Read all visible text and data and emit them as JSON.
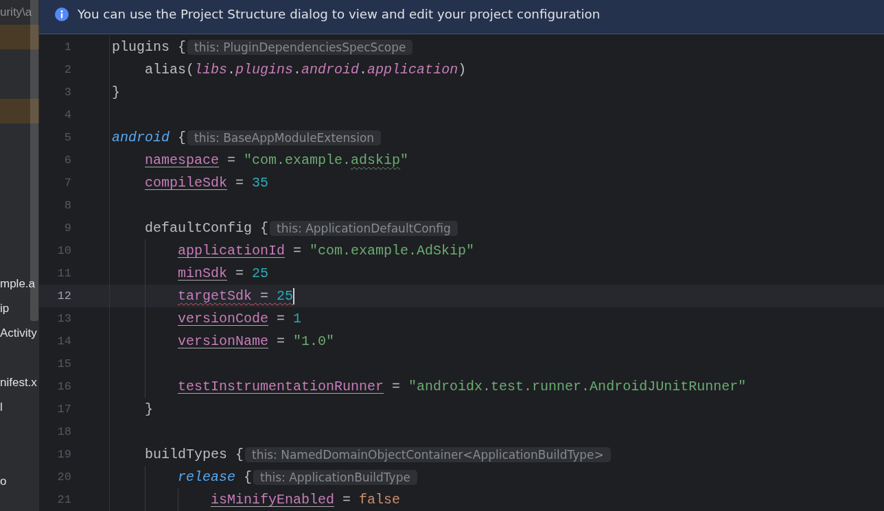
{
  "project_panel": {
    "rows": [
      {
        "label": "urity\\a",
        "kind": "path",
        "highlighted": false
      },
      {
        "highlighted": true
      },
      {
        "highlighted": false
      },
      {
        "highlighted": false
      },
      {
        "highlighted": true
      },
      {
        "highlighted": false
      },
      {
        "highlighted": false
      },
      {
        "highlighted": false
      },
      {
        "highlighted": false
      },
      {
        "highlighted": false
      },
      {
        "highlighted": false
      },
      {
        "label": "mple.a",
        "kind": "file",
        "highlighted": false
      },
      {
        "label": "ip",
        "kind": "file",
        "highlighted": false
      },
      {
        "label": "Activity",
        "kind": "file",
        "highlighted": false
      },
      {
        "highlighted": false
      },
      {
        "label": "nifest.x",
        "kind": "file",
        "highlighted": false
      },
      {
        "label": "l",
        "kind": "file",
        "highlighted": false
      },
      {
        "highlighted": false
      },
      {
        "highlighted": false
      },
      {
        "label": "o",
        "kind": "file",
        "highlighted": false
      }
    ]
  },
  "banner": {
    "message": "You can use the Project Structure dialog to view and edit your project configuration"
  },
  "editor": {
    "lines": [
      {
        "number": "1",
        "current": false,
        "warning": false,
        "tokens": [
          {
            "text": "plugins {",
            "kind": "plain"
          },
          {
            "text": "this: PluginDependenciesSpecScope",
            "kind": "hint"
          }
        ],
        "children": [
          {
            "number": "2",
            "current": false,
            "warning": false,
            "tokens": [
              {
                "text": "alias(",
                "kind": "plain"
              },
              {
                "text": "libs",
                "kind": "member"
              },
              {
                "text": ".",
                "kind": "plain"
              },
              {
                "text": "plugins",
                "kind": "member"
              },
              {
                "text": ".",
                "kind": "plain"
              },
              {
                "text": "android",
                "kind": "member"
              },
              {
                "text": ".",
                "kind": "plain"
              },
              {
                "text": "application",
                "kind": "member"
              },
              {
                "text": ")",
                "kind": "plain"
              }
            ]
          }
        ]
      },
      {
        "number": "3",
        "current": false,
        "warning": false,
        "tokens": [
          {
            "text": "}",
            "kind": "plain"
          }
        ]
      },
      {
        "number": "4",
        "current": false
      },
      {
        "number": "5",
        "current": false,
        "warning": false,
        "tokens": [
          {
            "text": "android",
            "kind": "receiver"
          },
          {
            "text": " {",
            "kind": "plain"
          },
          {
            "text": "this: BaseAppModuleExtension",
            "kind": "hint"
          }
        ],
        "children": [
          {
            "number": "6",
            "current": false,
            "warning": false,
            "tokens": [
              {
                "text": "namespace",
                "kind": "property"
              },
              {
                "text": " = ",
                "kind": "plain"
              },
              {
                "text": "\"com.example.",
                "kind": "string"
              },
              {
                "text": "adskip",
                "kind": "misspelling"
              },
              {
                "text": "\"",
                "kind": "string"
              }
            ]
          },
          {
            "number": "7",
            "current": false,
            "warning": false,
            "tokens": [
              {
                "text": "compileSdk",
                "kind": "property"
              },
              {
                "text": " = ",
                "kind": "plain"
              },
              {
                "text": "35",
                "kind": "number"
              }
            ]
          },
          {
            "number": "8",
            "current": false
          },
          {
            "number": "9",
            "current": false,
            "warning": false,
            "tokens": [
              {
                "text": "defaultConfig {",
                "kind": "plain"
              },
              {
                "text": "this: ApplicationDefaultConfig",
                "kind": "hint"
              }
            ],
            "children": [
              {
                "number": "10",
                "current": false,
                "warning": false,
                "tokens": [
                  {
                    "text": "applicationId",
                    "kind": "property"
                  },
                  {
                    "text": " = ",
                    "kind": "plain"
                  },
                  {
                    "text": "\"com.example.AdSkip\"",
                    "kind": "string"
                  }
                ]
              },
              {
                "number": "11",
                "current": false,
                "warning": false,
                "tokens": [
                  {
                    "text": "minSdk",
                    "kind": "property"
                  },
                  {
                    "text": " = ",
                    "kind": "plain"
                  },
                  {
                    "text": "25",
                    "kind": "number"
                  }
                ]
              },
              {
                "number": "12",
                "current": true,
                "warning": true,
                "tokens": [
                  {
                    "text": "targetSdk",
                    "kind": "property"
                  },
                  {
                    "text": " = ",
                    "kind": "plain"
                  },
                  {
                    "text": "25",
                    "kind": "number"
                  }
                ]
              },
              {
                "number": "13",
                "current": false,
                "warning": false,
                "tokens": [
                  {
                    "text": "versionCode",
                    "kind": "property"
                  },
                  {
                    "text": " = ",
                    "kind": "plain"
                  },
                  {
                    "text": "1",
                    "kind": "number"
                  }
                ]
              },
              {
                "number": "14",
                "current": false,
                "warning": false,
                "tokens": [
                  {
                    "text": "versionName",
                    "kind": "property"
                  },
                  {
                    "text": " = ",
                    "kind": "plain"
                  },
                  {
                    "text": "\"1.0\"",
                    "kind": "string"
                  }
                ]
              },
              {
                "number": "15",
                "current": false
              },
              {
                "number": "16",
                "current": false,
                "warning": false,
                "tokens": [
                  {
                    "text": "testInstrumentationRunner",
                    "kind": "property"
                  },
                  {
                    "text": " = ",
                    "kind": "plain"
                  },
                  {
                    "text": "\"androidx.test.runner.AndroidJUnitRunner\"",
                    "kind": "string"
                  }
                ]
              }
            ]
          },
          {
            "number": "17",
            "current": false,
            "warning": false,
            "tokens": [
              {
                "text": "}",
                "kind": "plain"
              }
            ]
          },
          {
            "number": "18",
            "current": false
          },
          {
            "number": "19",
            "current": false,
            "warning": false,
            "tokens": [
              {
                "text": "buildTypes {",
                "kind": "plain"
              },
              {
                "text": "this: NamedDomainObjectContainer<ApplicationBuildType>",
                "kind": "hint"
              }
            ],
            "children": [
              {
                "number": "20",
                "current": false,
                "warning": false,
                "tokens": [
                  {
                    "text": "release",
                    "kind": "receiver"
                  },
                  {
                    "text": " {",
                    "kind": "plain"
                  },
                  {
                    "text": "this: ApplicationBuildType",
                    "kind": "hint"
                  }
                ],
                "children": [
                  {
                    "number": "21",
                    "current": false,
                    "warning": false,
                    "tokens": [
                      {
                        "text": "isMinifyEnabled",
                        "kind": "property"
                      },
                      {
                        "text": " = ",
                        "kind": "plain"
                      },
                      {
                        "text": "false",
                        "kind": "keyword"
                      }
                    ]
                  }
                ]
              }
            ]
          }
        ]
      }
    ]
  }
}
